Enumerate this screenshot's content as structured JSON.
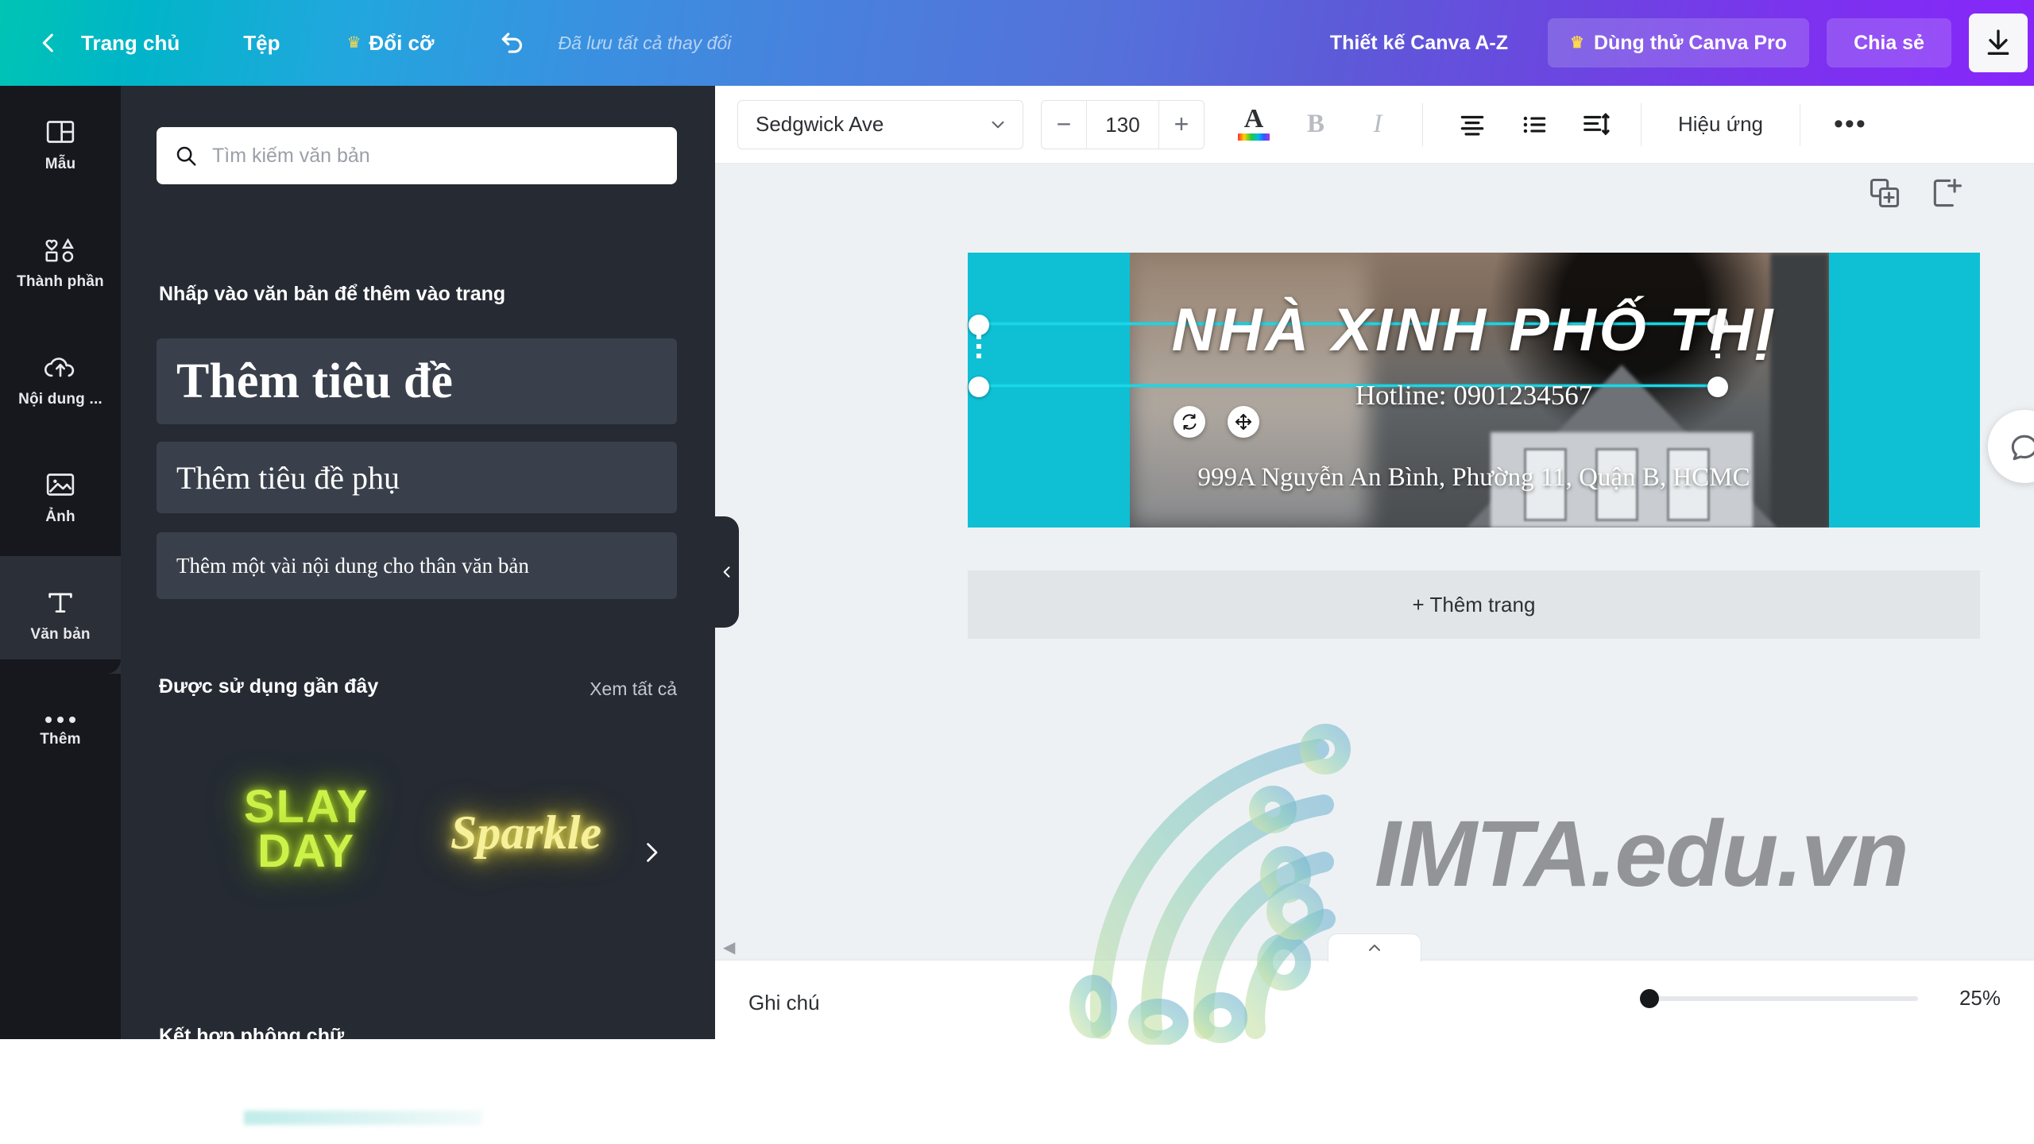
{
  "topbar": {
    "back_icon": "chevron-left-icon",
    "home_label": "Trang chủ",
    "file_label": "Tệp",
    "resize_label": "Đổi cỡ",
    "resize_crown": "♛",
    "undo_icon": "undo-icon",
    "save_status": "Đã lưu tất cả thay đổi",
    "design_az_label": "Thiết kế Canva A-Z",
    "pro_label": "Dùng thử Canva Pro",
    "pro_crown": "♛",
    "share_label": "Chia sẻ",
    "download_icon": "download-icon"
  },
  "rail": {
    "items": [
      {
        "label": "Mẫu",
        "icon": "template-layout-icon",
        "active": false
      },
      {
        "label": "Thành phần",
        "icon": "shapes-icon",
        "active": false
      },
      {
        "label": "Nội dung ...",
        "icon": "cloud-upload-icon",
        "active": false
      },
      {
        "label": "Ảnh",
        "icon": "photo-icon",
        "active": false
      },
      {
        "label": "Văn bản",
        "icon": "text-T-icon",
        "active": true
      },
      {
        "label": "Thêm",
        "icon": "more-dots-icon",
        "active": false
      }
    ]
  },
  "panel": {
    "search_placeholder": "Tìm kiếm văn bản",
    "search_value": "",
    "search_icon": "search-icon",
    "click_hint": "Nhấp vào văn bản để thêm vào trang",
    "add_heading": "Thêm tiêu đề",
    "add_subheading": "Thêm tiêu đề phụ",
    "add_body": "Thêm một vài nội dung cho thân văn bản",
    "recent_heading": "Được sử dụng gần đây",
    "see_all": "Xem tất cả",
    "recent_items": [
      {
        "line1": "SLAY",
        "line2": "DAY",
        "style": "neon-green"
      },
      {
        "line1": "Sparkle",
        "line2": "",
        "style": "neon-yellow"
      }
    ],
    "next_arrow_icon": "chevron-right-icon",
    "combine_heading": "Kết hợp phông chữ",
    "collapse_icon": "chevron-left-icon"
  },
  "toolbar": {
    "font_name": "Sedgwick Ave",
    "font_dropdown_icon": "chevron-down-icon",
    "size_decrease": "−",
    "font_size": "130",
    "size_increase": "+",
    "color_icon": "text-color-icon",
    "color_letter": "A",
    "bold_label": "B",
    "italic_label": "I",
    "align_icon": "align-center-icon",
    "list_icon": "bullet-list-icon",
    "spacing_icon": "line-spacing-icon",
    "effects_label": "Hiệu ứng",
    "more_label": "•••"
  },
  "canvas": {
    "duplicate_page_icon": "duplicate-page-icon",
    "add_page_icon": "add-page-icon",
    "rotate_icon": "rotate-icon",
    "move_icon": "move-icon",
    "comment_icon": "comment-bubble-icon",
    "add_page_label": "+ Thêm trang",
    "scroll_left_icon": "scroll-left-arrow-icon",
    "design": {
      "title": "NHÀ XINH PHỐ THỊ",
      "hotline": "Hotline: 0901234567",
      "address": "999A Nguyễn An Bình, Phường 11, Quận B, HCMC",
      "background_color": "#0fc0d4"
    }
  },
  "watermark": {
    "text": "IMTA.edu.vn",
    "logo_icon": "imta-spiral-logo-icon"
  },
  "bottombar": {
    "notes_label": "Ghi chú",
    "collapse_icon": "chevron-up-icon",
    "zoom_value": "25%"
  },
  "colors": {
    "brand_teal": "#00c4b4",
    "brand_purple": "#8726fb",
    "design_teal": "#0fc0d4",
    "panel_bg": "#252a33",
    "rail_bg": "#16181d",
    "selection": "#1ad6e6"
  }
}
